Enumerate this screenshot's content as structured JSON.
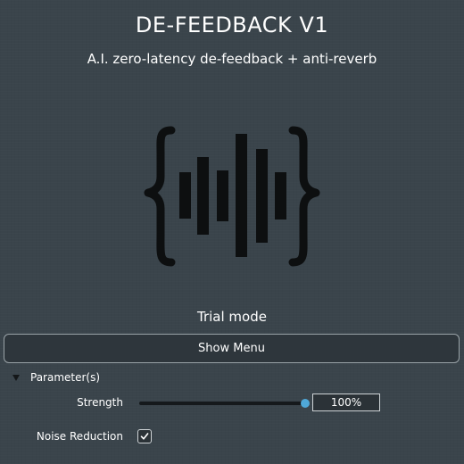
{
  "header": {
    "title": "DE-FEEDBACK V1",
    "subtitle": "A.I. zero-latency de-feedback + anti-reverb"
  },
  "logo": {
    "icon": "waveform-braces-logo-icon",
    "color": "#0d0f10"
  },
  "status": {
    "mode": "Trial mode"
  },
  "menu_button": {
    "label": "Show Menu"
  },
  "parameters": {
    "section_label": "Parameter(s)",
    "strength": {
      "label": "Strength",
      "value_text": "100%",
      "fraction": 1.0
    },
    "noise_reduction": {
      "label": "Noise Reduction",
      "checked": true
    }
  },
  "colors": {
    "background": "#3a444b",
    "accent": "#4fa8d8",
    "text": "#ffffff"
  }
}
